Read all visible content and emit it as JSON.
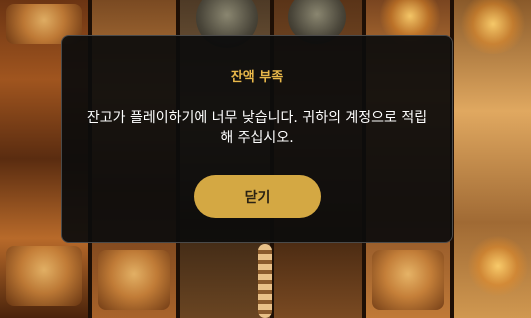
{
  "dialog": {
    "title": "잔액 부족",
    "message": "잔고가 플레이하기에 너무 낮습니다. 귀하의 계정으로 적립해 주십시오.",
    "close_label": "닫기",
    "title_color": "#e9b84a",
    "button_color": "#d4a843"
  }
}
